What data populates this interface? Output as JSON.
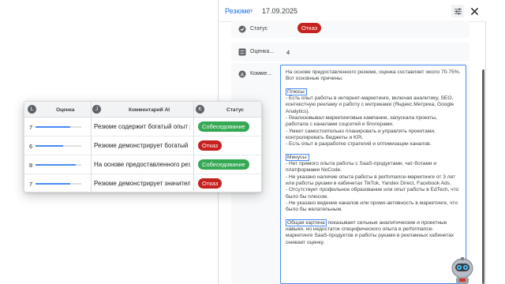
{
  "breadcrumb": {
    "link": "Резюме",
    "separator": "›",
    "current": "17.09.2025"
  },
  "icons": {
    "settings": "sliders-icon",
    "close": "close-icon",
    "status": "status-icon",
    "score": "score-icon",
    "comment": "comment-icon"
  },
  "fields": {
    "status": {
      "label": "Статус",
      "value": "Отказ"
    },
    "score": {
      "label": "Оценка...",
      "value": "4"
    },
    "comment": {
      "label": "Комме...",
      "intro": "На основе предоставленного резюме, оценка составляет около 70-75%. Вот основные причины:",
      "pros_title": "Плюсы:",
      "pros": [
        "- Есть опыт работы в интернет-маркетинге, включая аналитику, SEO, контекстную рекламу и работу с метриками (Яндекс.Метрика, Google Analytics).",
        "- Реализовывал маркетинговые кампании, запускала проекты, работала с каналами соцсетей и блогерами.",
        "- Умеет самостоятельно планировать и управлять проектами, контролировать бюджеты и KPI.",
        "- Есть опыт в разработке стратегий и оптимизации каналов."
      ],
      "cons_title": "Минусы:",
      "cons": [
        "- Нет прямого опыта работы с SaaS-продуктами, чат-ботами и платформами NoCode.",
        "- Не указано наличие опыта работы в perfomance-маркетинге от 3 лет или работы руками в кабинетах TikTok, Yandex Direct, Facebook Ads.",
        "- Отсутствует профильное образование или опыт работы в EdTech, что было бы плюсом.",
        "- Не указано ведение каналов или промо-активность в маркетинге, что было бы желательным."
      ],
      "summary_lead": "Общая картина",
      "summary_rest": " показывает сильные аналитические и проектные навыки, но недостаток специфического опыта в performance-маркетинге SaaS-продуктов и работы руками в рекламных кабинетах снижает оценку."
    }
  },
  "table": {
    "columns": [
      {
        "letter": "L",
        "title": "Оценка"
      },
      {
        "letter": "J",
        "title": "Комментарий AI"
      },
      {
        "letter": "K",
        "title": "Статус"
      }
    ],
    "rows": [
      {
        "score": "7",
        "score_fraction": 0.75,
        "comment": "Резюме содержит богатый опыт работы",
        "status": "Собеседование",
        "status_kind": "green"
      },
      {
        "score": "6",
        "score_fraction": 0.6,
        "comment": "Резюме демонстрирует богатый опыт",
        "status": "Отказ",
        "status_kind": "red"
      },
      {
        "score": "8",
        "score_fraction": 0.88,
        "comment": "На основе предоставленного резюме",
        "status": "Собеседование",
        "status_kind": "green"
      },
      {
        "score": "7",
        "score_fraction": 0.75,
        "comment": "Резюме демонстрирует значительный опыт",
        "status": "Отказ",
        "status_kind": "red"
      }
    ]
  },
  "colors": {
    "accent": "#1a73e8",
    "red": "#c5221f",
    "green": "#34a853",
    "bar": "#4a8af4"
  },
  "mascot": "robot-mascot"
}
